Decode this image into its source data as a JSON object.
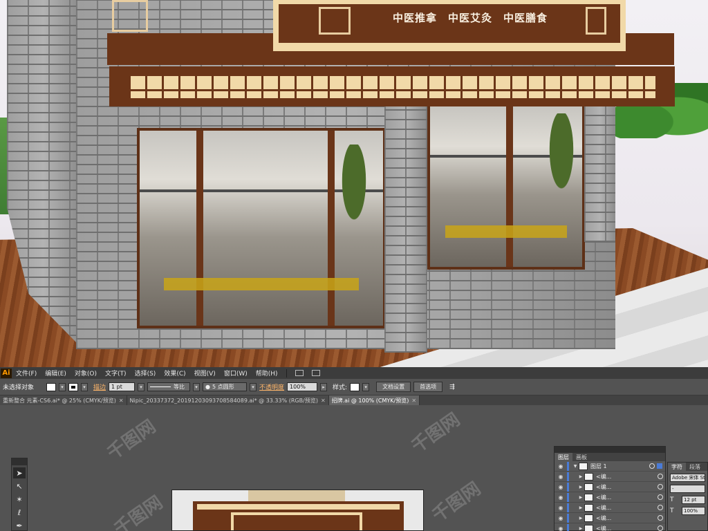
{
  "storefront": {
    "services": [
      "中医推拿",
      "中医艾灸",
      "中医膳食"
    ]
  },
  "watermark": "千图网",
  "menubar": {
    "app_icon": "Ai",
    "items": [
      "文件(F)",
      "编辑(E)",
      "对象(O)",
      "文字(T)",
      "选择(S)",
      "效果(C)",
      "视图(V)",
      "窗口(W)",
      "帮助(H)"
    ]
  },
  "control_bar": {
    "selection_status": "未选择对象",
    "stroke_label": "描边",
    "stroke_weight": "1 pt",
    "stroke_profile": "等比",
    "brush": "5 点圆形",
    "opacity_label": "不透明度",
    "opacity_value": "100%",
    "style_label": "样式:",
    "document_setup_button": "文档设置",
    "preferences_button": "首选项"
  },
  "document_tabs": [
    {
      "label": "重新整合 元素-CS6.ai* @ 25% (CMYK/预览)",
      "active": false
    },
    {
      "label": "Nipic_20337372_20191203093708584089.ai* @ 33.33% (RGB/预览)",
      "active": false
    },
    {
      "label": "招牌.ai @ 100% (CMYK/预览)",
      "active": true
    }
  ],
  "tools": [
    {
      "icon": "selection-tool-icon",
      "glyph": "➤"
    },
    {
      "icon": "direct-selection-tool-icon",
      "glyph": "↖"
    },
    {
      "icon": "magic-wand-tool-icon",
      "glyph": "✶"
    },
    {
      "icon": "lasso-tool-icon",
      "glyph": "ℓ"
    },
    {
      "icon": "pen-tool-icon",
      "glyph": "✒"
    }
  ],
  "layers_panel": {
    "tabs": [
      "图层",
      "画板"
    ],
    "top_layer": "图层 1",
    "sublayers": [
      "<编...",
      "<编...",
      "<编...",
      "<编...",
      "<编...",
      "<编..."
    ]
  },
  "character_panel": {
    "tabs": [
      "字符",
      "段落"
    ],
    "font_family": "Adobe 宋体 Std",
    "font_style": "-",
    "font_size": "12 pt",
    "horizontal_scale": "100%"
  },
  "colors": {
    "wood": "#6b3518",
    "cream": "#f1d9a8",
    "ui_dark": "#3c3c3c",
    "ui_mid": "#535353",
    "accent_orange": "#ff9a00",
    "layer_blue": "#4a7bd6"
  }
}
